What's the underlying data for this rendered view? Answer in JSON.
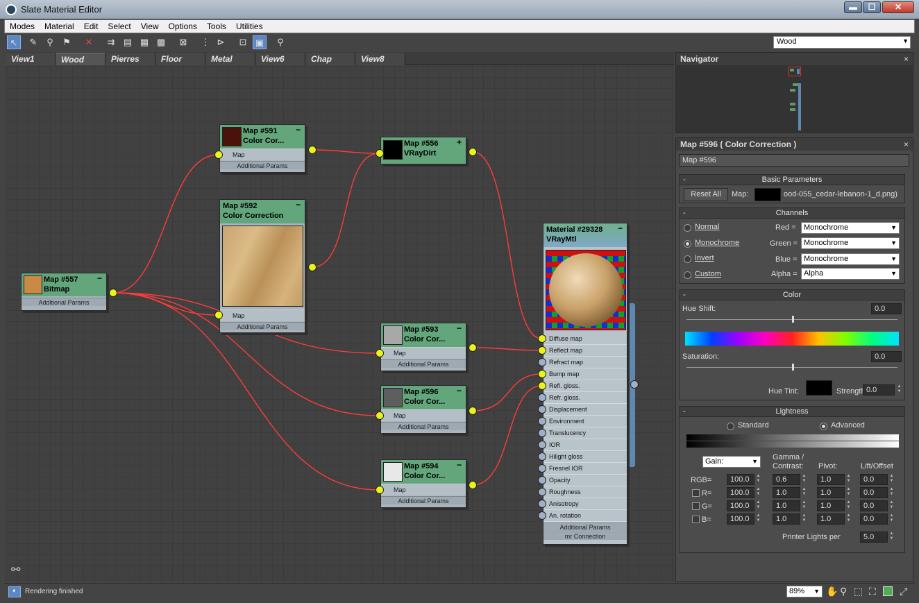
{
  "window": {
    "title": "Slate Material Editor"
  },
  "menu": [
    "Modes",
    "Material",
    "Edit",
    "Select",
    "View",
    "Options",
    "Tools",
    "Utilities"
  ],
  "material_select": {
    "value": "Wood"
  },
  "tabs": [
    "View1",
    "Wood",
    "Pierres",
    "Floor",
    "Metal",
    "View6",
    "Chap",
    "View8"
  ],
  "nodes": {
    "n591": {
      "title": "Map #591",
      "subtitle": "Color  Cor...",
      "slot": "Map",
      "extra": "Additional Params"
    },
    "n556": {
      "title": "Map #556",
      "subtitle": "VRayDirt"
    },
    "n592": {
      "title": "Map #592",
      "subtitle": "Color Correction",
      "slot": "Map",
      "extra": "Additional Params"
    },
    "n557": {
      "title": "Map #557",
      "subtitle": "Bitmap",
      "extra": "Additional Params"
    },
    "n593": {
      "title": "Map #593",
      "subtitle": "Color  Cor...",
      "slot": "Map",
      "extra": "Additional Params"
    },
    "n596": {
      "title": "Map #596",
      "subtitle": "Color  Cor...",
      "slot": "Map",
      "extra": "Additional Params"
    },
    "n594": {
      "title": "Map #594",
      "subtitle": "Color  Cor...",
      "slot": "Map",
      "extra": "Additional Params"
    },
    "mat": {
      "title": "Material #29328",
      "subtitle": "VRayMtl",
      "slots": [
        "Diffuse map",
        "Reflect map",
        "Refract map",
        "Bump map",
        "Refl. gloss.",
        "Refr. gloss.",
        "Displacement",
        "Environment",
        "Translucency",
        "IOR",
        "Hilight gloss",
        "Fresnel IOR",
        "Opacity",
        "Roughness",
        "Anisotropy",
        "An. rotation"
      ],
      "extra1": "Additional Params",
      "extra2": "mr Connection"
    }
  },
  "navigator": {
    "title": "Navigator"
  },
  "params": {
    "header": "Map #596  ( Color Correction )",
    "name": "Map #596",
    "basic": {
      "title": "Basic Parameters",
      "reset": "Reset All",
      "map_label": "Map:",
      "map_file": "ood-055_cedar-lebanon-1_d.png)"
    },
    "channels": {
      "title": "Channels",
      "modes": [
        "Normal",
        "Monochrome",
        "Invert",
        "Custom"
      ],
      "red_label": "Red =",
      "red": "Monochrome",
      "green_label": "Green =",
      "green": "Monochrome",
      "blue_label": "Blue =",
      "blue": "Monochrome",
      "alpha_label": "Alpha =",
      "alpha": "Alpha"
    },
    "color": {
      "title": "Color",
      "hue_shift_label": "Hue Shift:",
      "hue_shift": "0.0",
      "saturation_label": "Saturation:",
      "saturation": "0.0",
      "hue_tint_label": "Hue Tint:",
      "strength_label": "Strength:",
      "strength": "0.0"
    },
    "lightness": {
      "title": "Lightness",
      "standard": "Standard",
      "advanced": "Advanced",
      "gain": "Gain:",
      "gamma_label": "Gamma /",
      "contrast_label": "Contrast:",
      "pivot_label": "Pivot:",
      "lift_label": "Lift/Offset",
      "rows": [
        {
          "label": "RGB=",
          "gain": "100.0",
          "gamma": "0.6",
          "pivot": "1.0",
          "lift": "0.0"
        },
        {
          "label": "R=",
          "gain": "100.0",
          "gamma": "1.0",
          "pivot": "1.0",
          "lift": "0.0"
        },
        {
          "label": "G=",
          "gain": "100.0",
          "gamma": "1.0",
          "pivot": "1.0",
          "lift": "0.0"
        },
        {
          "label": "B=",
          "gain": "100.0",
          "gamma": "1.0",
          "pivot": "1.0",
          "lift": "0.0"
        }
      ],
      "printer_label": "Printer Lights per",
      "printer": "5.0"
    }
  },
  "status": {
    "text": "Rendering finished",
    "zoom": "89%"
  },
  "colors": {
    "node_header": "#63a67c",
    "wire": "#ff3b3b",
    "port_active": "#e9f51a",
    "selection": "#5b87c4"
  }
}
